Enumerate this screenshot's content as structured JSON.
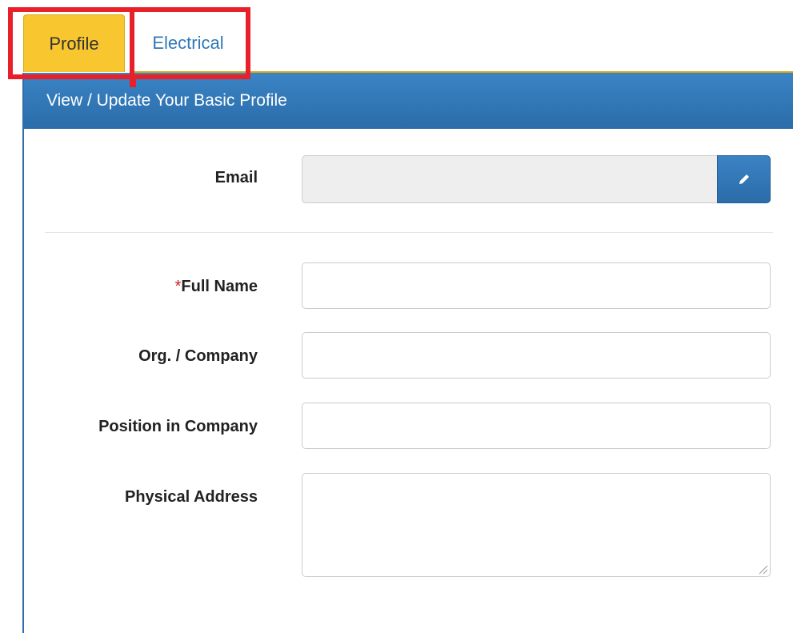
{
  "tabs": [
    {
      "label": "Profile",
      "active": true
    },
    {
      "label": "Electrical",
      "active": false
    }
  ],
  "panel": {
    "heading": "View / Update Your Basic Profile"
  },
  "form": {
    "email": {
      "label": "Email",
      "value": ""
    },
    "full_name": {
      "required_mark": "*",
      "label": "Full Name",
      "value": ""
    },
    "company": {
      "label": "Org. / Company",
      "value": ""
    },
    "position": {
      "label": "Position in Company",
      "value": ""
    },
    "address": {
      "label": "Physical Address",
      "value": ""
    }
  },
  "icons": {
    "edit": "pencil-icon"
  },
  "colors": {
    "active_tab": "#f8c730",
    "panel_heading": "#337ab7",
    "link": "#3179b7",
    "highlight": "#e8202a",
    "required": "#cc1f1f"
  }
}
